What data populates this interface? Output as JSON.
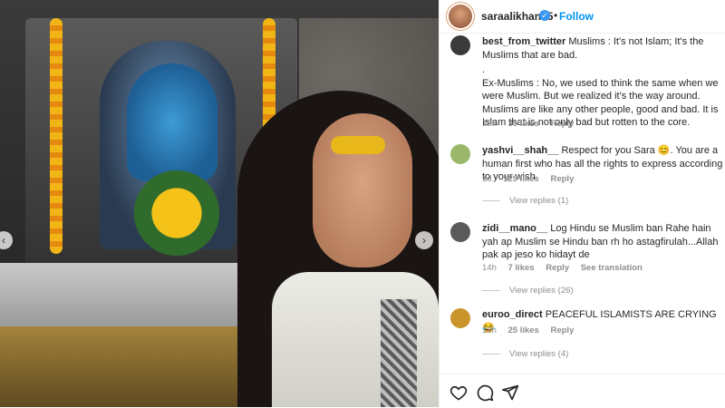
{
  "post": {
    "username": "saraalikhan95",
    "verified_glyph": "✓",
    "separator": "•",
    "follow_label": "Follow",
    "nav_prev": "‹",
    "nav_next": "›"
  },
  "comments": [
    {
      "username": "best_from_twitter",
      "text": "Muslims : It's not Islam; It's the Muslims that are bad.",
      "text2": ".",
      "text3": "Ex-Muslims : No, we used to think the same when we were Muslim. But we realized it's the way around. Muslims are like any other people, good and bad. It is Islam that is not only bad but rotten to the core.",
      "time": "18h",
      "likes": "39 likes",
      "reply": "Reply",
      "avatar_color": "#3a3a3a"
    },
    {
      "username": "yashvi__shah__",
      "text": "Respect for you Sara 😊. You are a human first who has all the rights to express according to your wish.",
      "time": "1d",
      "likes": "129 likes",
      "reply": "Reply",
      "view_replies": "View replies (1)",
      "avatar_color": "#9bb86a"
    },
    {
      "username": "zidi__mano__",
      "text": "Log Hindu se Muslim ban Rahe hain yah ap Muslim se Hindu ban rh ho astagfirulah...Allah pak ap jeso ko hidayt de",
      "time": "14h",
      "likes": "7 likes",
      "reply": "Reply",
      "translation": "See translation",
      "view_replies": "View replies (26)",
      "avatar_color": "#5a5a5a"
    },
    {
      "username": "euroo_direct",
      "text": "PEACEFUL ISLAMISTS ARE CRYING 😂",
      "time": "15h",
      "likes": "25 likes",
      "reply": "Reply",
      "view_replies": "View replies (4)",
      "avatar_color": "#c9952b"
    }
  ],
  "footer": {
    "icons": [
      "heart-icon",
      "comment-icon",
      "share-icon"
    ]
  }
}
